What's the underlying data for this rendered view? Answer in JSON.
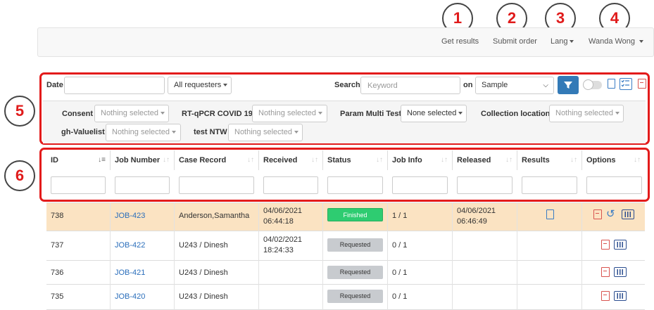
{
  "callouts": [
    "1",
    "2",
    "3",
    "4",
    "5",
    "6"
  ],
  "nav": {
    "get_results": "Get results",
    "submit_order": "Submit order",
    "lang": "Lang",
    "user": "Wanda Wong"
  },
  "filters": {
    "date_label": "Date",
    "requesters": "All requesters",
    "search_label": "Search",
    "keyword_placeholder": "Keyword",
    "on_label": "on",
    "on_value": "Sample",
    "consent_label": "Consent",
    "consent_value": "Nothing selected",
    "rtqpcr_label": "RT-qPCR COVID 19",
    "rtqpcr_value": "Nothing selected",
    "param_label": "Param Multi Test",
    "param_value": "None selected",
    "collection_label": "Collection location",
    "collection_value": "Nothing selected",
    "valuelist_label": "gh-Valuelist",
    "valuelist_value": "Nothing selected",
    "testntw_label": "test NTW",
    "testntw_value": "Nothing selected"
  },
  "columns": [
    "ID",
    "Job Number",
    "Case Record",
    "Received",
    "Status",
    "Job Info",
    "Released",
    "Results",
    "Options"
  ],
  "rows": [
    {
      "id": "738",
      "job": "JOB-423",
      "case": "Anderson,Samantha",
      "received_date": "04/06/2021",
      "received_time": "06:44:18",
      "status": "Finished",
      "info": "1 / 1",
      "released_date": "04/06/2021",
      "released_time": "06:46:49"
    },
    {
      "id": "737",
      "job": "JOB-422",
      "case": "U243 / Dinesh",
      "received_date": "04/02/2021",
      "received_time": "18:24:33",
      "status": "Requested",
      "info": "0 / 1",
      "released_date": "",
      "released_time": ""
    },
    {
      "id": "736",
      "job": "JOB-421",
      "case": "U243 / Dinesh",
      "received_date": "",
      "received_time": "",
      "status": "Requested",
      "info": "0 / 1",
      "released_date": "",
      "released_time": ""
    },
    {
      "id": "735",
      "job": "JOB-420",
      "case": "U243 / Dinesh",
      "received_date": "",
      "received_time": "",
      "status": "Requested",
      "info": "0 / 1",
      "released_date": "",
      "released_time": ""
    }
  ],
  "colors": {
    "callout_red": "#e01b1b",
    "finished_green": "#2ecc71",
    "requested_gray": "#c8cbcf",
    "highlight_row": "#fbe3c2",
    "primary_blue": "#337ab7"
  },
  "icons": [
    "filter-icon",
    "toggle-switch",
    "export-icon",
    "checklist-icon",
    "pdf-icon",
    "document-icon",
    "refresh-icon",
    "barcode-icon"
  ]
}
